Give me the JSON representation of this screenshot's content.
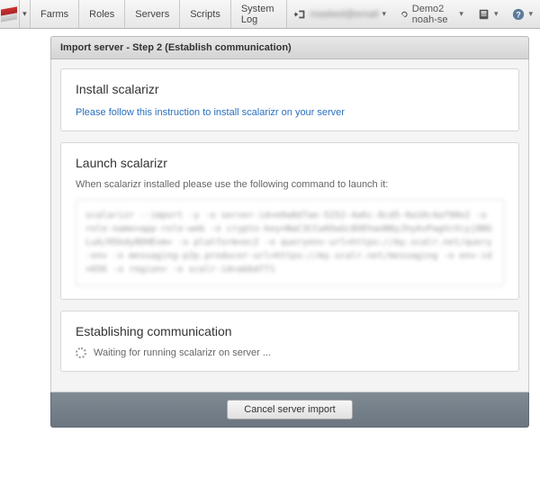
{
  "nav": {
    "items": [
      "Farms",
      "Roles",
      "Servers",
      "Scripts",
      "System Log"
    ]
  },
  "account": {
    "masked": "masked@email",
    "env_label": "Demo2 noah-se"
  },
  "header": {
    "title": "Import server - Step 2 (Establish communication)"
  },
  "install": {
    "heading": "Install scalarizr",
    "link": "Please follow this instruction to install scalarizr on your server"
  },
  "launch": {
    "heading": "Launch scalarizr",
    "desc": "When scalarizr installed please use the following command to launch it:",
    "command": "scalarizr --import -y -o server-id=e0a8d7ae-5252-4a6c-8cd5-0a10c4af98e2 -o role-name=app-role-web -o crypto-key=NaC3CCw6OwGc8OEhaoN8yJhyAvPagVcVcyj8BGLuA/H5kdy8DHExm= -o platform=ec2 -o queryenv-url=https://my.scalr.net/query-env -o messaging-p2p.producer-url=https://my.scalr.net/messaging -o env-id=656 -o region= -o scalr-id=abbdf71"
  },
  "status": {
    "heading": "Establishing communication",
    "text": "Waiting for running scalarizr on server ..."
  },
  "footer": {
    "cancel": "Cancel server import"
  }
}
